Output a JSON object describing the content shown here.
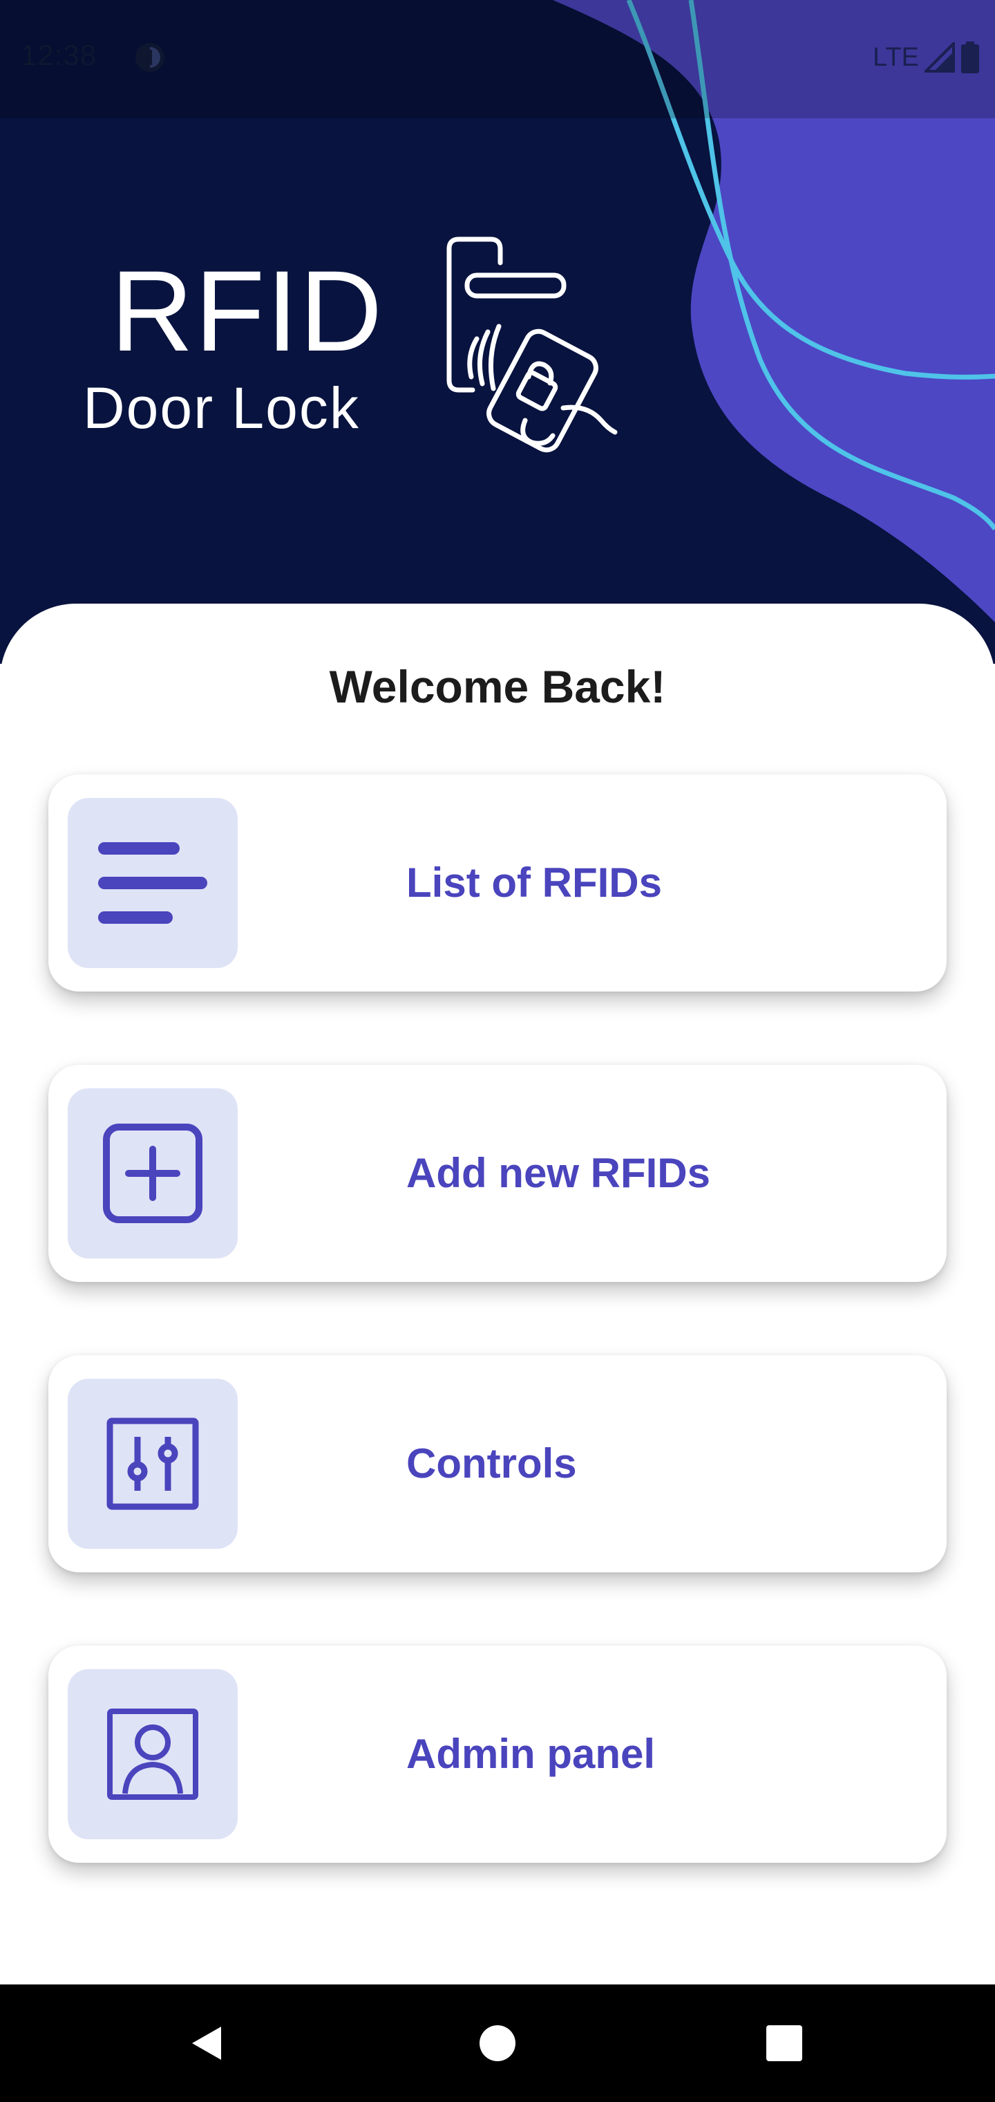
{
  "status_bar": {
    "time": "12:38",
    "network": "LTE"
  },
  "header": {
    "logo_title": "RFID",
    "logo_subtitle": "Door Lock"
  },
  "main": {
    "welcome": "Welcome Back!",
    "menu": [
      {
        "label": "List of RFIDs",
        "icon": "list-icon"
      },
      {
        "label": "Add new RFIDs",
        "icon": "add-square-icon"
      },
      {
        "label": "Controls",
        "icon": "sliders-icon"
      },
      {
        "label": "Admin panel",
        "icon": "user-portrait-icon"
      }
    ]
  },
  "colors": {
    "hero_navy": "#08133f",
    "hero_purple": "#4d47c4",
    "accent": "#4a44bd",
    "icon_tile": "#dfe3f6",
    "wave_line": "#4fc3e8"
  },
  "nav_bar": {
    "back": "back-icon",
    "home": "home-icon",
    "recents": "recents-icon"
  }
}
